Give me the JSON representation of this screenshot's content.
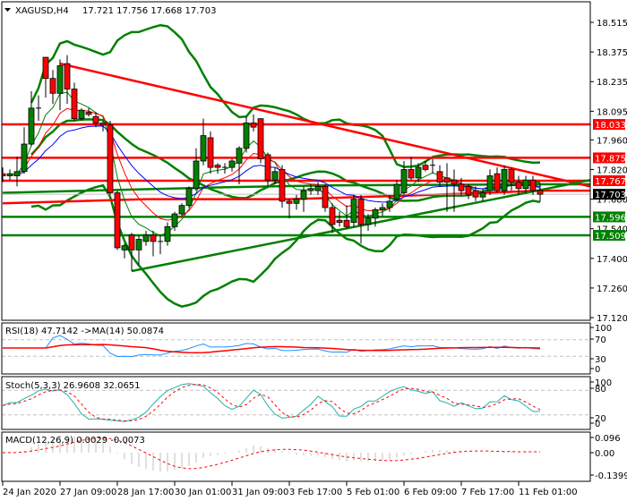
{
  "header": {
    "icon": "triangle-down-icon",
    "symbol": "XAGUSD,H4",
    "ohlc": "17.721 17.756 17.668 17.703"
  },
  "chart_data": {
    "type": "candlestick",
    "colors": {
      "bull": "#008000",
      "bear": "#ff0000",
      "band": "#008000",
      "ma_fast": "#008000",
      "ma_mid": "#ff0000",
      "ma_slow": "#0000ff"
    },
    "price_ticks": [
      "18.515",
      "18.375",
      "18.235",
      "18.095",
      "17.960",
      "17.820",
      "17.680",
      "17.540",
      "17.400",
      "17.260",
      "17.120"
    ],
    "time_labels": [
      "24 Jan 2020",
      "27 Jan 09:00",
      "28 Jan 17:00",
      "30 Jan 01:00",
      "31 Jan 09:00",
      "3 Feb 17:00",
      "5 Feb 01:00",
      "6 Feb 09:00",
      "7 Feb 17:00",
      "11 Feb 01:00"
    ],
    "current_price": {
      "value": "17.703",
      "color": "#000000"
    },
    "levels": [
      {
        "value": "18.033",
        "color": "#ff0000"
      },
      {
        "value": "17.875",
        "color": "#ff0000"
      },
      {
        "value": "17.767",
        "color": "#ff0000"
      },
      {
        "value": "17.596",
        "color": "#008000"
      },
      {
        "value": "17.509",
        "color": "#008000"
      }
    ],
    "trendlines": [
      {
        "color": "#ff0000",
        "from": [
          8,
          18.32
        ],
        "to": [
          82,
          17.74
        ]
      },
      {
        "color": "#008000",
        "from": [
          18,
          17.34
        ],
        "to": [
          82,
          17.77
        ]
      }
    ],
    "long_mas": [
      {
        "color": "#008000",
        "points": [
          [
            0,
            17.71
          ],
          [
            30,
            17.735
          ],
          [
            45,
            17.745
          ],
          [
            75,
            17.75
          ]
        ]
      },
      {
        "color": "#ff0000",
        "points": [
          [
            0,
            17.66
          ],
          [
            20,
            17.68
          ],
          [
            40,
            17.68
          ],
          [
            60,
            17.7
          ],
          [
            75,
            17.72
          ]
        ]
      }
    ],
    "candles": [
      [
        17.8,
        17.83,
        17.76,
        17.79
      ],
      [
        17.79,
        17.82,
        17.77,
        17.8
      ],
      [
        17.79,
        17.88,
        17.74,
        17.81
      ],
      [
        17.81,
        18.02,
        17.8,
        17.94
      ],
      [
        17.94,
        18.19,
        17.93,
        18.11
      ],
      [
        18.11,
        18.17,
        18.05,
        18.11
      ],
      [
        18.35,
        18.35,
        18.16,
        18.25
      ],
      [
        18.25,
        18.29,
        18.13,
        18.18
      ],
      [
        18.18,
        18.34,
        18.1,
        18.31
      ],
      [
        18.32,
        18.36,
        18.13,
        18.2
      ],
      [
        18.2,
        18.23,
        18.05,
        18.06
      ],
      [
        18.06,
        18.11,
        18.05,
        18.1
      ],
      [
        18.09,
        18.11,
        18.07,
        18.08
      ],
      [
        18.07,
        18.09,
        18.02,
        18.04
      ],
      [
        18.04,
        18.05,
        18.0,
        18.03
      ],
      [
        18.03,
        18.05,
        17.7,
        17.71
      ],
      [
        17.71,
        17.72,
        17.44,
        17.45
      ],
      [
        17.44,
        17.47,
        17.4,
        17.46
      ],
      [
        17.51,
        17.52,
        17.34,
        17.44
      ],
      [
        17.44,
        17.51,
        17.37,
        17.49
      ],
      [
        17.48,
        17.53,
        17.46,
        17.51
      ],
      [
        17.51,
        17.53,
        17.41,
        17.48
      ],
      [
        17.48,
        17.51,
        17.42,
        17.48
      ],
      [
        17.48,
        17.57,
        17.46,
        17.55
      ],
      [
        17.55,
        17.62,
        17.53,
        17.61
      ],
      [
        17.61,
        17.66,
        17.6,
        17.65
      ],
      [
        17.65,
        17.74,
        17.64,
        17.73
      ],
      [
        17.73,
        17.92,
        17.72,
        17.86
      ],
      [
        17.86,
        18.06,
        17.84,
        17.98
      ],
      [
        17.97,
        18.0,
        17.8,
        17.83
      ],
      [
        17.84,
        17.85,
        17.8,
        17.83
      ],
      [
        17.83,
        17.85,
        17.8,
        17.83
      ],
      [
        17.83,
        17.87,
        17.81,
        17.86
      ],
      [
        17.85,
        17.93,
        17.75,
        17.92
      ],
      [
        17.92,
        18.07,
        17.9,
        18.04
      ],
      [
        18.04,
        18.08,
        18.0,
        18.02
      ],
      [
        18.06,
        18.06,
        17.85,
        17.87
      ],
      [
        17.89,
        17.9,
        17.74,
        17.77
      ],
      [
        17.77,
        17.83,
        17.75,
        17.81
      ],
      [
        17.82,
        17.84,
        17.64,
        17.67
      ],
      [
        17.67,
        17.68,
        17.59,
        17.66
      ],
      [
        17.66,
        17.7,
        17.63,
        17.68
      ],
      [
        17.68,
        17.74,
        17.62,
        17.72
      ],
      [
        17.72,
        17.75,
        17.7,
        17.73
      ],
      [
        17.72,
        17.76,
        17.7,
        17.74
      ],
      [
        17.74,
        17.75,
        17.62,
        17.64
      ],
      [
        17.64,
        17.66,
        17.52,
        17.56
      ],
      [
        17.58,
        17.62,
        17.55,
        17.57
      ],
      [
        17.58,
        17.65,
        17.54,
        17.55
      ],
      [
        17.57,
        17.7,
        17.55,
        17.68
      ],
      [
        17.68,
        17.7,
        17.47,
        17.56
      ],
      [
        17.56,
        17.61,
        17.53,
        17.59
      ],
      [
        17.59,
        17.64,
        17.55,
        17.63
      ],
      [
        17.63,
        17.66,
        17.6,
        17.64
      ],
      [
        17.64,
        17.7,
        17.62,
        17.67
      ],
      [
        17.68,
        17.77,
        17.67,
        17.75
      ],
      [
        17.71,
        17.86,
        17.7,
        17.82
      ],
      [
        17.82,
        17.88,
        17.77,
        17.78
      ],
      [
        17.78,
        17.85,
        17.76,
        17.83
      ],
      [
        17.84,
        17.86,
        17.81,
        17.82
      ],
      [
        17.84,
        17.87,
        17.8,
        17.84
      ],
      [
        17.81,
        17.84,
        17.74,
        17.76
      ],
      [
        17.78,
        17.85,
        17.62,
        17.76
      ],
      [
        17.77,
        17.82,
        17.62,
        17.75
      ],
      [
        17.75,
        17.78,
        17.7,
        17.72
      ],
      [
        17.74,
        17.75,
        17.68,
        17.7
      ],
      [
        17.72,
        17.74,
        17.67,
        17.69
      ],
      [
        17.69,
        17.73,
        17.67,
        17.71
      ],
      [
        17.72,
        17.82,
        17.7,
        17.79
      ],
      [
        17.8,
        17.83,
        17.71,
        17.72
      ],
      [
        17.72,
        17.84,
        17.7,
        17.82
      ],
      [
        17.82,
        17.83,
        17.72,
        17.76
      ],
      [
        17.76,
        17.79,
        17.7,
        17.73
      ],
      [
        17.73,
        17.79,
        17.71,
        17.77
      ],
      [
        17.77,
        17.79,
        17.7,
        17.72
      ],
      [
        17.721,
        17.756,
        17.668,
        17.703
      ]
    ],
    "rsi": {
      "label": "RSI(18) 47.7142  ->MA(14) 50.0874",
      "ticks": [
        "100",
        "70",
        "30",
        "0"
      ]
    },
    "stoch": {
      "label": "Stoch(5,3,3) 26.9608 32.0651",
      "ticks": [
        "100",
        "80",
        "20",
        "0"
      ]
    },
    "macd": {
      "label": "MACD(12,26,9) 0.0029 -0.0073",
      "ticks": [
        "0.096",
        "0.00",
        "-0.1399"
      ]
    }
  }
}
